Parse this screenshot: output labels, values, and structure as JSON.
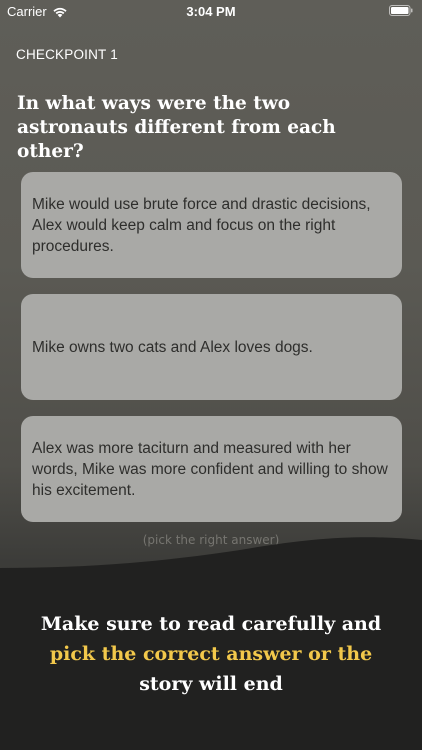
{
  "status_bar": {
    "carrier": "Carrier",
    "time": "3:04 PM",
    "icons": [
      "wifi-icon",
      "battery-icon"
    ]
  },
  "checkpoint": "CHECKPOINT 1",
  "question": "In what ways were the two astronauts different from each other?",
  "answers": [
    {
      "text": "Mike would use brute force and drastic decisions, Alex would keep calm and focus on the right procedures."
    },
    {
      "text": "Mike owns two cats and Alex loves dogs."
    },
    {
      "text": "Alex was more taciturn and measured with her words, Mike was more confident and willing to show his excitement."
    }
  ],
  "hint": "(pick the right answer)",
  "notice": {
    "line1": "Make sure to read carefully and",
    "line2_highlight": "pick the correct answer or the",
    "line3": "story will end"
  },
  "colors": {
    "background_top": "#5f5e58",
    "card": "#a9a9a6",
    "card_text": "#2e2e2c",
    "panel": "#212120",
    "highlight": "#f2c84b"
  }
}
